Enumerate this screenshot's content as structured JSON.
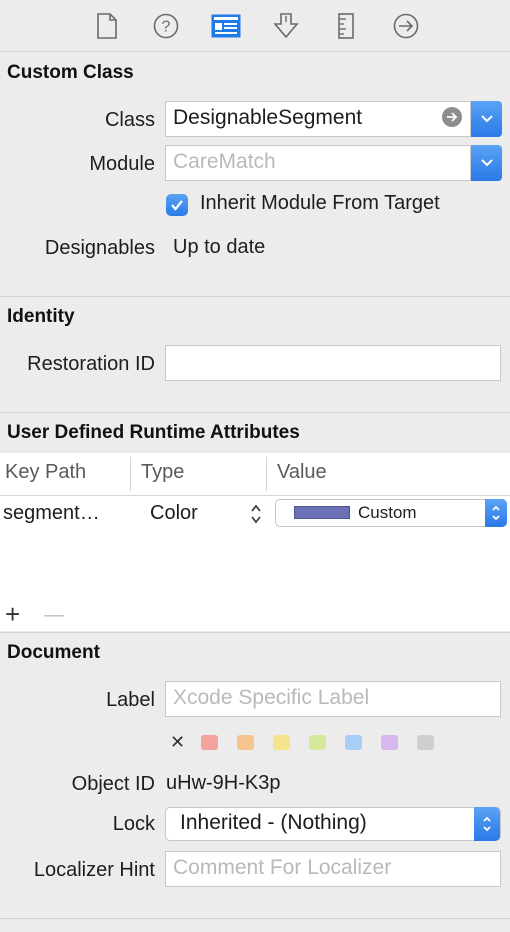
{
  "toolbar": {
    "icons": [
      "file-icon",
      "help-icon",
      "identity-icon",
      "attributes-icon",
      "size-icon",
      "connections-icon"
    ],
    "accent": "#1f7be9"
  },
  "custom_class": {
    "title": "Custom Class",
    "class_label": "Class",
    "class_value": "DesignableSegment",
    "module_label": "Module",
    "module_placeholder": "CareMatch",
    "inherit_checked": true,
    "inherit_label": "Inherit Module From Target",
    "designables_label": "Designables",
    "designables_value": "Up to date"
  },
  "identity": {
    "title": "Identity",
    "restoration_label": "Restoration ID",
    "restoration_value": ""
  },
  "runtime_attributes": {
    "title": "User Defined Runtime Attributes",
    "columns": [
      "Key Path",
      "Type",
      "Value"
    ],
    "rows": [
      {
        "key_path": "segment…",
        "type": "Color",
        "value": "Custom",
        "color": "#6b71b4"
      }
    ],
    "add_symbol": "+",
    "remove_symbol": "—"
  },
  "document": {
    "title": "Document",
    "label_label": "Label",
    "label_placeholder": "Xcode Specific Label",
    "clear_symbol": "✕",
    "label_colors": [
      "#f2a39b",
      "#f6c58f",
      "#f4e58c",
      "#d6e89a",
      "#a9cdf6",
      "#d7b7ef",
      "#cfcfcf"
    ],
    "object_id_label": "Object ID",
    "object_id_value": "uHw-9H-K3p",
    "lock_label": "Lock",
    "lock_value": "Inherited - (Nothing)",
    "localizer_label": "Localizer Hint",
    "localizer_placeholder": "Comment For Localizer"
  }
}
